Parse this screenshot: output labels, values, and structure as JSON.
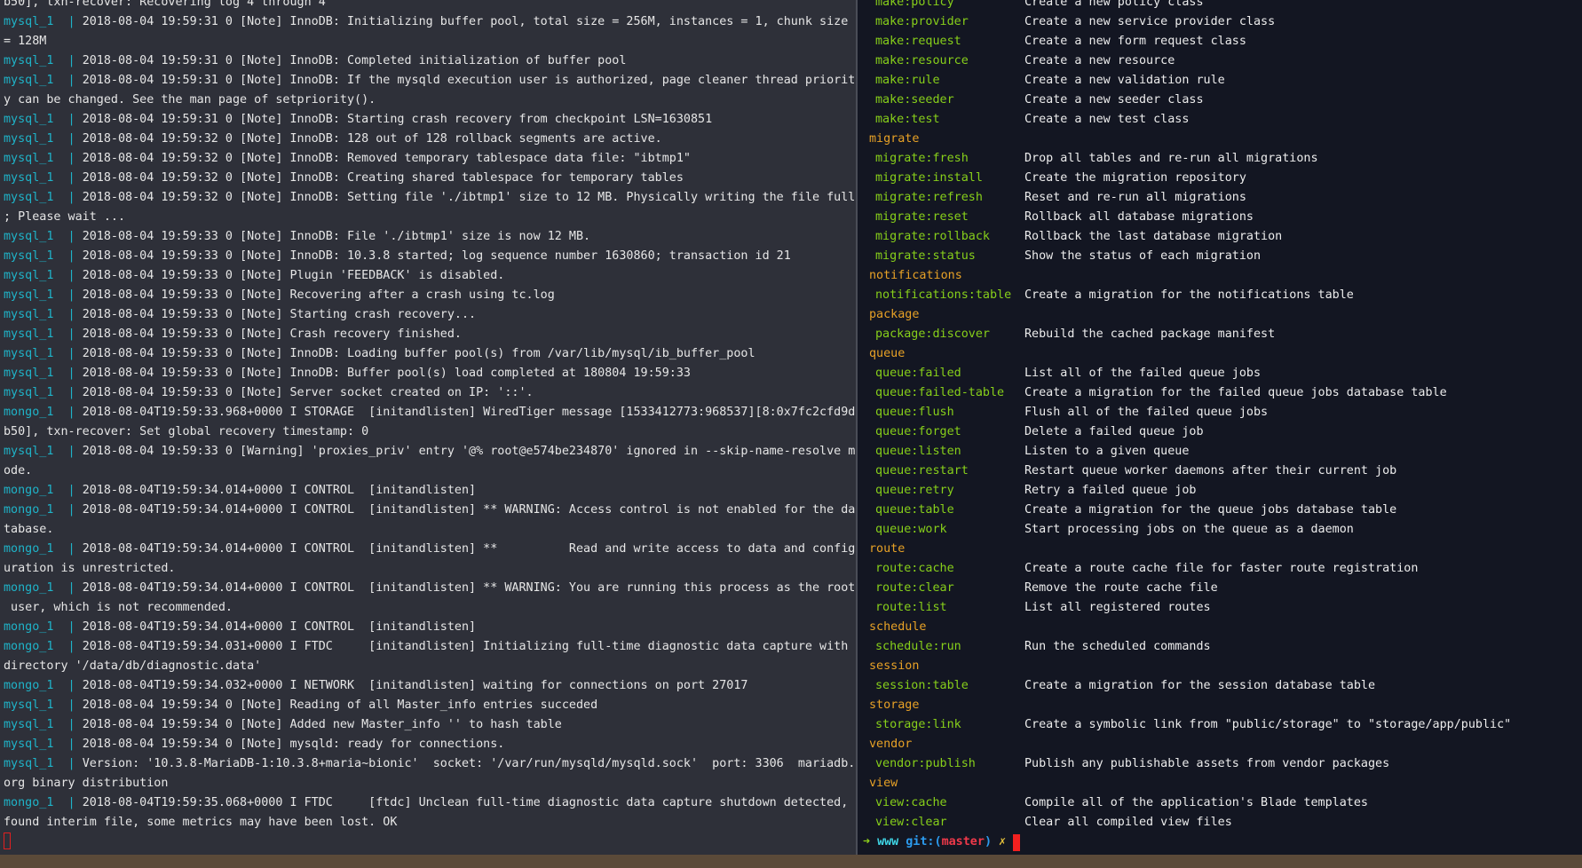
{
  "colors": {
    "container_prefix": "#1fb3c8",
    "section_header": "#e7a126",
    "command": "#87cf1a",
    "cursor": "#f2201f"
  },
  "left_pane": {
    "lines": [
      {
        "prefix": "",
        "text": "b50], txn-recover: Recovering log 4 through 4"
      },
      {
        "prefix": "mysql_1  | ",
        "text": "2018-08-04 19:59:31 0 [Note] InnoDB: Initializing buffer pool, total size = 256M, instances = 1, chunk size"
      },
      {
        "prefix": "",
        "text": "= 128M"
      },
      {
        "prefix": "mysql_1  | ",
        "text": "2018-08-04 19:59:31 0 [Note] InnoDB: Completed initialization of buffer pool"
      },
      {
        "prefix": "mysql_1  | ",
        "text": "2018-08-04 19:59:31 0 [Note] InnoDB: If the mysqld execution user is authorized, page cleaner thread priorit"
      },
      {
        "prefix": "",
        "text": "y can be changed. See the man page of setpriority()."
      },
      {
        "prefix": "mysql_1  | ",
        "text": "2018-08-04 19:59:31 0 [Note] InnoDB: Starting crash recovery from checkpoint LSN=1630851"
      },
      {
        "prefix": "mysql_1  | ",
        "text": "2018-08-04 19:59:32 0 [Note] InnoDB: 128 out of 128 rollback segments are active."
      },
      {
        "prefix": "mysql_1  | ",
        "text": "2018-08-04 19:59:32 0 [Note] InnoDB: Removed temporary tablespace data file: \"ibtmp1\""
      },
      {
        "prefix": "mysql_1  | ",
        "text": "2018-08-04 19:59:32 0 [Note] InnoDB: Creating shared tablespace for temporary tables"
      },
      {
        "prefix": "mysql_1  | ",
        "text": "2018-08-04 19:59:32 0 [Note] InnoDB: Setting file './ibtmp1' size to 12 MB. Physically writing the file full"
      },
      {
        "prefix": "",
        "text": "; Please wait ..."
      },
      {
        "prefix": "mysql_1  | ",
        "text": "2018-08-04 19:59:33 0 [Note] InnoDB: File './ibtmp1' size is now 12 MB."
      },
      {
        "prefix": "mysql_1  | ",
        "text": "2018-08-04 19:59:33 0 [Note] InnoDB: 10.3.8 started; log sequence number 1630860; transaction id 21"
      },
      {
        "prefix": "mysql_1  | ",
        "text": "2018-08-04 19:59:33 0 [Note] Plugin 'FEEDBACK' is disabled."
      },
      {
        "prefix": "mysql_1  | ",
        "text": "2018-08-04 19:59:33 0 [Note] Recovering after a crash using tc.log"
      },
      {
        "prefix": "mysql_1  | ",
        "text": "2018-08-04 19:59:33 0 [Note] Starting crash recovery..."
      },
      {
        "prefix": "mysql_1  | ",
        "text": "2018-08-04 19:59:33 0 [Note] Crash recovery finished."
      },
      {
        "prefix": "mysql_1  | ",
        "text": "2018-08-04 19:59:33 0 [Note] InnoDB: Loading buffer pool(s) from /var/lib/mysql/ib_buffer_pool"
      },
      {
        "prefix": "mysql_1  | ",
        "text": "2018-08-04 19:59:33 0 [Note] InnoDB: Buffer pool(s) load completed at 180804 19:59:33"
      },
      {
        "prefix": "mysql_1  | ",
        "text": "2018-08-04 19:59:33 0 [Note] Server socket created on IP: '::'."
      },
      {
        "prefix": "mongo_1  | ",
        "text": "2018-08-04T19:59:33.968+0000 I STORAGE  [initandlisten] WiredTiger message [1533412773:968537][8:0x7fc2cfd9d"
      },
      {
        "prefix": "",
        "text": "b50], txn-recover: Set global recovery timestamp: 0"
      },
      {
        "prefix": "mysql_1  | ",
        "text": "2018-08-04 19:59:33 0 [Warning] 'proxies_priv' entry '@% root@e574be234870' ignored in --skip-name-resolve m"
      },
      {
        "prefix": "",
        "text": "ode."
      },
      {
        "prefix": "mongo_1  | ",
        "text": "2018-08-04T19:59:34.014+0000 I CONTROL  [initandlisten]"
      },
      {
        "prefix": "mongo_1  | ",
        "text": "2018-08-04T19:59:34.014+0000 I CONTROL  [initandlisten] ** WARNING: Access control is not enabled for the da"
      },
      {
        "prefix": "",
        "text": "tabase."
      },
      {
        "prefix": "mongo_1  | ",
        "text": "2018-08-04T19:59:34.014+0000 I CONTROL  [initandlisten] **          Read and write access to data and config"
      },
      {
        "prefix": "",
        "text": "uration is unrestricted."
      },
      {
        "prefix": "mongo_1  | ",
        "text": "2018-08-04T19:59:34.014+0000 I CONTROL  [initandlisten] ** WARNING: You are running this process as the root"
      },
      {
        "prefix": "",
        "text": " user, which is not recommended."
      },
      {
        "prefix": "mongo_1  | ",
        "text": "2018-08-04T19:59:34.014+0000 I CONTROL  [initandlisten]"
      },
      {
        "prefix": "mongo_1  | ",
        "text": "2018-08-04T19:59:34.031+0000 I FTDC     [initandlisten] Initializing full-time diagnostic data capture with"
      },
      {
        "prefix": "",
        "text": "directory '/data/db/diagnostic.data'"
      },
      {
        "prefix": "mongo_1  | ",
        "text": "2018-08-04T19:59:34.032+0000 I NETWORK  [initandlisten] waiting for connections on port 27017"
      },
      {
        "prefix": "mysql_1  | ",
        "text": "2018-08-04 19:59:34 0 [Note] Reading of all Master_info entries succeded"
      },
      {
        "prefix": "mysql_1  | ",
        "text": "2018-08-04 19:59:34 0 [Note] Added new Master_info '' to hash table"
      },
      {
        "prefix": "mysql_1  | ",
        "text": "2018-08-04 19:59:34 0 [Note] mysqld: ready for connections."
      },
      {
        "prefix": "mysql_1  | ",
        "text": "Version: '10.3.8-MariaDB-1:10.3.8+maria~bionic'  socket: '/var/run/mysqld/mysqld.sock'  port: 3306  mariadb."
      },
      {
        "prefix": "",
        "text": "org binary distribution"
      },
      {
        "prefix": "mongo_1  | ",
        "text": "2018-08-04T19:59:35.068+0000 I FTDC     [ftdc] Unclean full-time diagnostic data capture shutdown detected,"
      },
      {
        "prefix": "",
        "text": "found interim file, some metrics may have been lost. OK"
      }
    ]
  },
  "right_pane": {
    "rows": [
      {
        "cmd": "make:policy",
        "desc": "Create a new policy class"
      },
      {
        "cmd": "make:provider",
        "desc": "Create a new service provider class"
      },
      {
        "cmd": "make:request",
        "desc": "Create a new form request class"
      },
      {
        "cmd": "make:resource",
        "desc": "Create a new resource"
      },
      {
        "cmd": "make:rule",
        "desc": "Create a new validation rule"
      },
      {
        "cmd": "make:seeder",
        "desc": "Create a new seeder class"
      },
      {
        "cmd": "make:test",
        "desc": "Create a new test class"
      },
      {
        "header": "migrate"
      },
      {
        "cmd": "migrate:fresh",
        "desc": "Drop all tables and re-run all migrations"
      },
      {
        "cmd": "migrate:install",
        "desc": "Create the migration repository"
      },
      {
        "cmd": "migrate:refresh",
        "desc": "Reset and re-run all migrations"
      },
      {
        "cmd": "migrate:reset",
        "desc": "Rollback all database migrations"
      },
      {
        "cmd": "migrate:rollback",
        "desc": "Rollback the last database migration"
      },
      {
        "cmd": "migrate:status",
        "desc": "Show the status of each migration"
      },
      {
        "header": "notifications"
      },
      {
        "cmd": "notifications:table",
        "desc": "Create a migration for the notifications table"
      },
      {
        "header": "package"
      },
      {
        "cmd": "package:discover",
        "desc": "Rebuild the cached package manifest"
      },
      {
        "header": "queue"
      },
      {
        "cmd": "queue:failed",
        "desc": "List all of the failed queue jobs"
      },
      {
        "cmd": "queue:failed-table",
        "desc": "Create a migration for the failed queue jobs database table"
      },
      {
        "cmd": "queue:flush",
        "desc": "Flush all of the failed queue jobs"
      },
      {
        "cmd": "queue:forget",
        "desc": "Delete a failed queue job"
      },
      {
        "cmd": "queue:listen",
        "desc": "Listen to a given queue"
      },
      {
        "cmd": "queue:restart",
        "desc": "Restart queue worker daemons after their current job"
      },
      {
        "cmd": "queue:retry",
        "desc": "Retry a failed queue job"
      },
      {
        "cmd": "queue:table",
        "desc": "Create a migration for the queue jobs database table"
      },
      {
        "cmd": "queue:work",
        "desc": "Start processing jobs on the queue as a daemon"
      },
      {
        "header": "route"
      },
      {
        "cmd": "route:cache",
        "desc": "Create a route cache file for faster route registration"
      },
      {
        "cmd": "route:clear",
        "desc": "Remove the route cache file"
      },
      {
        "cmd": "route:list",
        "desc": "List all registered routes"
      },
      {
        "header": "schedule"
      },
      {
        "cmd": "schedule:run",
        "desc": "Run the scheduled commands"
      },
      {
        "header": "session"
      },
      {
        "cmd": "session:table",
        "desc": "Create a migration for the session database table"
      },
      {
        "header": "storage"
      },
      {
        "cmd": "storage:link",
        "desc": "Create a symbolic link from \"public/storage\" to \"storage/app/public\""
      },
      {
        "header": "vendor"
      },
      {
        "cmd": "vendor:publish",
        "desc": "Publish any publishable assets from vendor packages"
      },
      {
        "header": "view"
      },
      {
        "cmd": "view:cache",
        "desc": "Compile all of the application's Blade templates"
      },
      {
        "cmd": "view:clear",
        "desc": "Clear all compiled view files"
      }
    ],
    "prompt": {
      "arrow": "➜",
      "dir": "www",
      "git_open": "git:(",
      "branch": "master",
      "git_close": ")",
      "dirty": "✗"
    }
  }
}
